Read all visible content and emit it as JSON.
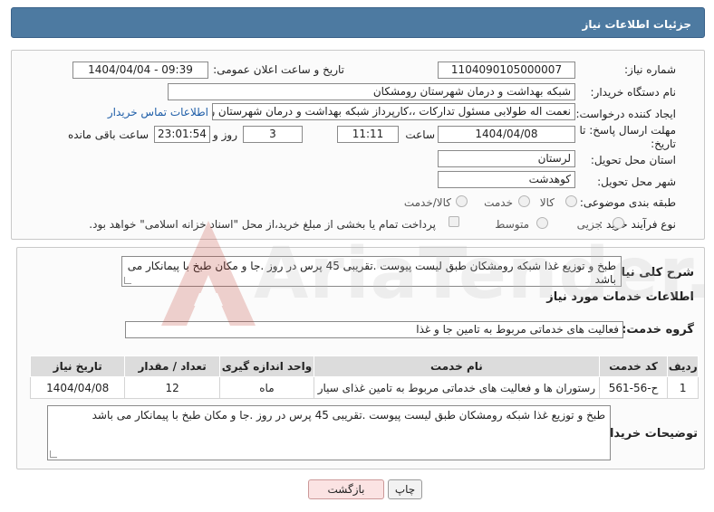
{
  "header": {
    "title": "جزئیات اطلاعات نیاز"
  },
  "form": {
    "need_number_label": "شماره نیاز:",
    "need_number": "1104090105000007",
    "announce_label": "تاریخ و ساعت اعلان عمومی:",
    "announce_value": "1404/04/04 - 09:39",
    "buyer_org_label": "نام دستگاه خریدار:",
    "buyer_org": "شبکه بهداشت و درمان شهرستان رومشکان",
    "creator_label": "ایجاد کننده درخواست:",
    "creator": "نعمت اله طولابی مسئول تدارکات ،،کارپرداز شبکه بهداشت و درمان شهرستان رو",
    "contact_link": "اطلاعات تماس خریدار",
    "deadline_label_1": "مهلت ارسال پاسخ: تا",
    "deadline_label_2": "تاریخ:",
    "deadline_date": "1404/04/08",
    "time_label": "ساعت",
    "deadline_time": "11:11",
    "days_value": "3",
    "days_label": "روز و",
    "remaining_time": "23:01:54",
    "remaining_label": "ساعت باقی مانده",
    "province_label": "استان محل تحویل:",
    "province": "لرستان",
    "city_label": "شهر محل تحویل:",
    "city": "کوهدشت",
    "category_label": "طبقه بندی موضوعی:",
    "category_options": [
      "کالا",
      "خدمت",
      "کالا/خدمت"
    ],
    "process_label": "نوع فرآیند خرید :",
    "process_options": [
      "جزیی",
      "متوسط"
    ],
    "payment_note": "پرداخت تمام یا بخشی از مبلغ خرید،از محل \"اسناد خزانه اسلامی\" خواهد بود."
  },
  "summary": {
    "label": "شرح کلی نیاز:",
    "text": "طبخ و توزیع غذا شبکه رومشکان طبق لیست پیوست .تقریبی 45 پرس در روز .جا و مکان طبخ با پیمانکار می باشد"
  },
  "services": {
    "section_title": "اطلاعات خدمات مورد نیاز",
    "group_label": "گروه خدمت:",
    "group_value": "فعالیت های خدماتی مربوط به تامین جا و غذا",
    "headers": [
      "ردیف",
      "کد خدمت",
      "نام خدمت",
      "واحد اندازه گیری",
      "تعداد / مقدار",
      "تاریخ نیاز"
    ],
    "rows": [
      [
        "1",
        "ح-56-561",
        "رستوران ها و فعالیت های خدماتی مربوط به تامین غذای سیار",
        "ماه",
        "12",
        "1404/04/08"
      ]
    ]
  },
  "buyer_notes": {
    "label": "توضیحات خریدار:",
    "text": "طبخ و توزیع غذا شبکه رومشکان طبق لیست پیوست .تقریبی 45 پرس در روز .جا و مکان طبخ با پیمانکار می باشد"
  },
  "buttons": {
    "print": "چاپ",
    "back": "بازگشت"
  },
  "watermark": {
    "text": "AriaTender.neT"
  },
  "colors": {
    "header_bg": "#4d7aa1",
    "link": "#1f5ea8",
    "back_button_bg": "#fbe3e3",
    "watermark": "#c0392b"
  }
}
